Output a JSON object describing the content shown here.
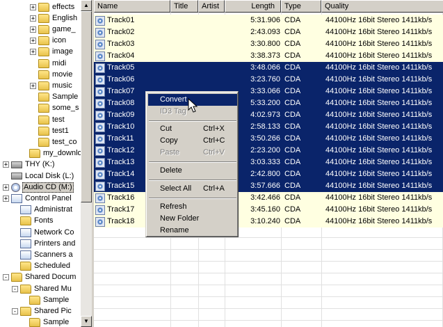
{
  "tree": [
    {
      "label": "effects",
      "indent": 3,
      "expander": "+",
      "icon": "folder"
    },
    {
      "label": "English",
      "indent": 3,
      "expander": "+",
      "icon": "folder"
    },
    {
      "label": "game_",
      "indent": 3,
      "expander": "+",
      "icon": "folder"
    },
    {
      "label": "icon",
      "indent": 3,
      "expander": "+",
      "icon": "folder"
    },
    {
      "label": "image",
      "indent": 3,
      "expander": "+",
      "icon": "folder"
    },
    {
      "label": "midi",
      "indent": 3,
      "expander": "",
      "icon": "folder"
    },
    {
      "label": "movie",
      "indent": 3,
      "expander": "",
      "icon": "folder"
    },
    {
      "label": "music",
      "indent": 3,
      "expander": "+",
      "icon": "folder"
    },
    {
      "label": "Sample",
      "indent": 3,
      "expander": "",
      "icon": "folder"
    },
    {
      "label": "some_s",
      "indent": 3,
      "expander": "",
      "icon": "folder"
    },
    {
      "label": "test",
      "indent": 3,
      "expander": "",
      "icon": "folder"
    },
    {
      "label": "test1",
      "indent": 3,
      "expander": "",
      "icon": "folder"
    },
    {
      "label": "test_co",
      "indent": 3,
      "expander": "",
      "icon": "folder"
    },
    {
      "label": "my_downlo",
      "indent": 2,
      "expander": "",
      "icon": "folder"
    },
    {
      "label": "THY (K:)",
      "indent": 0,
      "expander": "+",
      "icon": "drive"
    },
    {
      "label": "Local Disk (L:)",
      "indent": 0,
      "expander": "",
      "icon": "drive"
    },
    {
      "label": "Audio CD (M:)",
      "indent": 0,
      "expander": "+",
      "icon": "cd",
      "selected": true
    },
    {
      "label": "Control Panel",
      "indent": 0,
      "expander": "+",
      "icon": "cpanel"
    },
    {
      "label": "Administrat",
      "indent": 1,
      "expander": "",
      "icon": "cpanel"
    },
    {
      "label": "Fonts",
      "indent": 1,
      "expander": "",
      "icon": "folder"
    },
    {
      "label": "Network Co",
      "indent": 1,
      "expander": "",
      "icon": "cpanel"
    },
    {
      "label": "Printers and",
      "indent": 1,
      "expander": "",
      "icon": "cpanel"
    },
    {
      "label": "Scanners a",
      "indent": 1,
      "expander": "",
      "icon": "cpanel"
    },
    {
      "label": "Scheduled",
      "indent": 1,
      "expander": "",
      "icon": "folder"
    },
    {
      "label": "Shared Docum",
      "indent": 0,
      "expander": "-",
      "icon": "folder"
    },
    {
      "label": "Shared Mu",
      "indent": 1,
      "expander": "-",
      "icon": "folder"
    },
    {
      "label": "Sample",
      "indent": 2,
      "expander": "",
      "icon": "folder"
    },
    {
      "label": "Shared Pic",
      "indent": 1,
      "expander": "-",
      "icon": "folder"
    },
    {
      "label": "Sample",
      "indent": 2,
      "expander": "",
      "icon": "folder"
    }
  ],
  "columns": [
    {
      "label": "Name"
    },
    {
      "label": "Title"
    },
    {
      "label": "Artist"
    },
    {
      "label": "Length"
    },
    {
      "label": "Type"
    },
    {
      "label": "Quality"
    }
  ],
  "tracks": [
    {
      "name": "Track01",
      "length": "5:31.906",
      "type": "CDA",
      "quality": "44100Hz 16bit Stereo 1411kb/s",
      "selected": false
    },
    {
      "name": "Track02",
      "length": "2:43.093",
      "type": "CDA",
      "quality": "44100Hz 16bit Stereo 1411kb/s",
      "selected": false
    },
    {
      "name": "Track03",
      "length": "3:30.800",
      "type": "CDA",
      "quality": "44100Hz 16bit Stereo 1411kb/s",
      "selected": false
    },
    {
      "name": "Track04",
      "length": "3:38.373",
      "type": "CDA",
      "quality": "44100Hz 16bit Stereo 1411kb/s",
      "selected": false
    },
    {
      "name": "Track05",
      "length": "3:48.066",
      "type": "CDA",
      "quality": "44100Hz 16bit Stereo 1411kb/s",
      "selected": true
    },
    {
      "name": "Track06",
      "length": "3:23.760",
      "type": "CDA",
      "quality": "44100Hz 16bit Stereo 1411kb/s",
      "selected": true
    },
    {
      "name": "Track07",
      "length": "3:33.066",
      "type": "CDA",
      "quality": "44100Hz 16bit Stereo 1411kb/s",
      "selected": true
    },
    {
      "name": "Track08",
      "length": "5:33.200",
      "type": "CDA",
      "quality": "44100Hz 16bit Stereo 1411kb/s",
      "selected": true
    },
    {
      "name": "Track09",
      "length": "4:02.973",
      "type": "CDA",
      "quality": "44100Hz 16bit Stereo 1411kb/s",
      "selected": true
    },
    {
      "name": "Track10",
      "length": "2:58.133",
      "type": "CDA",
      "quality": "44100Hz 16bit Stereo 1411kb/s",
      "selected": true
    },
    {
      "name": "Track11",
      "length": "3:50.266",
      "type": "CDA",
      "quality": "44100Hz 16bit Stereo 1411kb/s",
      "selected": true
    },
    {
      "name": "Track12",
      "length": "2:23.200",
      "type": "CDA",
      "quality": "44100Hz 16bit Stereo 1411kb/s",
      "selected": true
    },
    {
      "name": "Track13",
      "length": "3:03.333",
      "type": "CDA",
      "quality": "44100Hz 16bit Stereo 1411kb/s",
      "selected": true
    },
    {
      "name": "Track14",
      "length": "2:42.800",
      "type": "CDA",
      "quality": "44100Hz 16bit Stereo 1411kb/s",
      "selected": true
    },
    {
      "name": "Track15",
      "length": "3:57.666",
      "type": "CDA",
      "quality": "44100Hz 16bit Stereo 1411kb/s",
      "selected": true
    },
    {
      "name": "Track16",
      "length": "3:42.466",
      "type": "CDA",
      "quality": "44100Hz 16bit Stereo 1411kb/s",
      "selected": false
    },
    {
      "name": "Track17",
      "length": "3:45.160",
      "type": "CDA",
      "quality": "44100Hz 16bit Stereo 1411kb/s",
      "selected": false
    },
    {
      "name": "Track18",
      "length": "3:10.240",
      "type": "CDA",
      "quality": "44100Hz 16bit Stereo 1411kb/s",
      "selected": false
    }
  ],
  "context_menu": {
    "convert": "Convert",
    "id3_tag": "ID3 Tag",
    "cut": "Cut",
    "cut_shortcut": "Ctrl+X",
    "copy": "Copy",
    "copy_shortcut": "Ctrl+C",
    "paste": "Paste",
    "paste_shortcut": "Ctrl+V",
    "delete": "Delete",
    "select_all": "Select All",
    "select_all_shortcut": "Ctrl+A",
    "refresh": "Refresh",
    "new_folder": "New Folder",
    "rename": "Rename"
  },
  "colors": {
    "selection": "#0a246a",
    "row_background": "#ffffe1",
    "window_face": "#d4d0c8"
  }
}
